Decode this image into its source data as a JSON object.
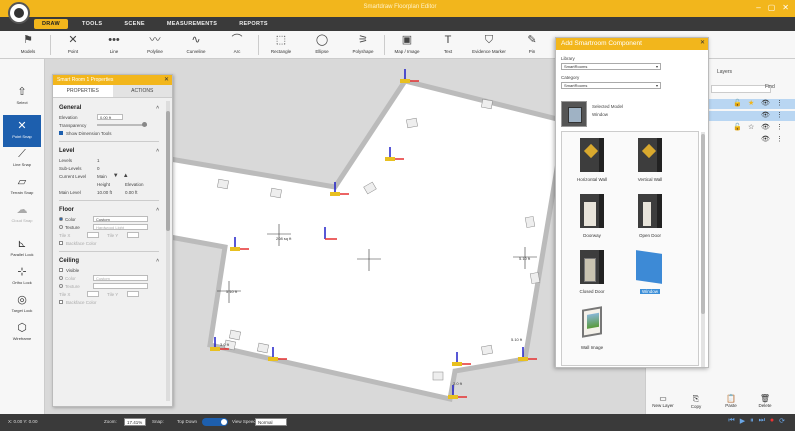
{
  "window": {
    "title": "Smartdraw Floorplan Editor",
    "controls": [
      "–",
      "▢",
      "✕"
    ]
  },
  "menu": [
    "DRAW",
    "TOOLS",
    "SCENE",
    "MEASUREMENTS",
    "REPORTS"
  ],
  "toolbar": [
    {
      "label": "Models",
      "icon": "⚑"
    },
    {
      "label": "Point",
      "icon": "✕"
    },
    {
      "label": "Line",
      "icon": "•••"
    },
    {
      "label": "Polyline",
      "icon": "〰"
    },
    {
      "label": "Curveline",
      "icon": "∿"
    },
    {
      "label": "Arc",
      "icon": "⌒"
    },
    {
      "label": "Rectangle",
      "icon": "⬚"
    },
    {
      "label": "Ellipse",
      "icon": "◯"
    },
    {
      "label": "Polyshape",
      "icon": "⚞"
    },
    {
      "label": "Map / Image",
      "icon": "▣"
    },
    {
      "label": "Text",
      "icon": "T"
    },
    {
      "label": "Evidence Marker",
      "icon": "⛉"
    },
    {
      "label": "Pin",
      "icon": "✎"
    }
  ],
  "left_tools": [
    {
      "label": "Select",
      "icon": "⇧",
      "state": "normal"
    },
    {
      "label": "Point Snap",
      "icon": "✕",
      "state": "active"
    },
    {
      "label": "Line Snap",
      "icon": "⟋",
      "state": "normal"
    },
    {
      "label": "Terrain Snap",
      "icon": "▱",
      "state": "normal"
    },
    {
      "label": "Cloud Snap",
      "icon": "☁",
      "state": "dim"
    },
    {
      "label": "Parallel Lock",
      "icon": "⊾",
      "state": "normal"
    },
    {
      "label": "Ortho Lock",
      "icon": "⊹",
      "state": "normal"
    },
    {
      "label": "Target Lock",
      "icon": "◎",
      "state": "normal"
    },
    {
      "label": "Wireframe",
      "icon": "⬡",
      "state": "normal"
    }
  ],
  "properties_panel": {
    "title": "Smart Room 1 Properties",
    "tabs": [
      "PROPERTIES",
      "ACTIONS"
    ],
    "general": {
      "title": "General",
      "elevation_label": "Elevation",
      "elevation_value": "0.00 ft",
      "transparency_label": "Transparency",
      "show_dim_label": "Show Dimension Tools"
    },
    "level": {
      "title": "Level",
      "levels_label": "Levels",
      "levels_value": "1",
      "sublevels_label": "Sub-Levels",
      "sublevels_value": "0",
      "current_label": "Current Level",
      "current_value": "Main",
      "height_label": "Height",
      "elev_label": "Elevation",
      "main_level_label": "Main Level",
      "main_height": "10.00 ft",
      "main_elev": "0.00 ft"
    },
    "floor": {
      "title": "Floor",
      "color_label": "Color",
      "texture_label": "Texture",
      "color_value": "Custom",
      "texture_value": "Hardwood Light",
      "tile_x": "Tile X",
      "tile_y": "Tile Y",
      "backface_label": "Backface Color"
    },
    "ceiling": {
      "title": "Ceiling",
      "visible_label": "Visible",
      "color_label": "Color",
      "texture_label": "Texture",
      "color_value": "Custom",
      "tile_x": "Tile X",
      "tile_y": "Tile Y",
      "backface_label": "Backface Color"
    }
  },
  "smartroom": {
    "title": "Add Smartroom Component",
    "library_label": "Library",
    "library_value": "SmartRooms",
    "category_label": "Category",
    "category_value": "SmartRooms",
    "selected_model_label": "Selected Model",
    "selected_model_value": "Window",
    "components": [
      {
        "label": "Horizontal Wall",
        "kind": "hwall"
      },
      {
        "label": "Vertical Wall",
        "kind": "vwall"
      },
      {
        "label": "Doorway",
        "kind": "doorway"
      },
      {
        "label": "Open Door",
        "kind": "opendoor"
      },
      {
        "label": "Closed Door",
        "kind": "closeddoor"
      },
      {
        "label": "Window",
        "kind": "window",
        "selected": true
      },
      {
        "label": "Wall Image",
        "kind": "wallimage"
      }
    ]
  },
  "layers": {
    "tab_label": "Layers",
    "find_label": "Find",
    "actions": [
      {
        "label": "New Layer",
        "icon": "▭"
      },
      {
        "label": "Copy",
        "icon": "⎘"
      },
      {
        "label": "Paste",
        "icon": "📋"
      },
      {
        "label": "Delete",
        "icon": "🗑"
      }
    ]
  },
  "canvas_labels": {
    "label_a": "208 sq ft",
    "label_b": "5.10 ft",
    "label_c": "5.10 ft",
    "label_d": "5.10 ft",
    "label_e": "3.0 ft",
    "label_f": "2.0 ft"
  },
  "status": {
    "zoom_label": "Zoom:",
    "zoom_value": "17.41%",
    "snap_label": "Snap:",
    "top_down_label": "Top Down",
    "view_label": "View Speed:",
    "view_value": "Normal",
    "coords": "X: 0.00  Y: 0.00"
  },
  "colors": {
    "accent": "#f2b61c",
    "active_tool": "#1d5fae",
    "axis_x": "#e53030",
    "axis_y": "#2020c8",
    "axis_z": "#e8c020"
  }
}
